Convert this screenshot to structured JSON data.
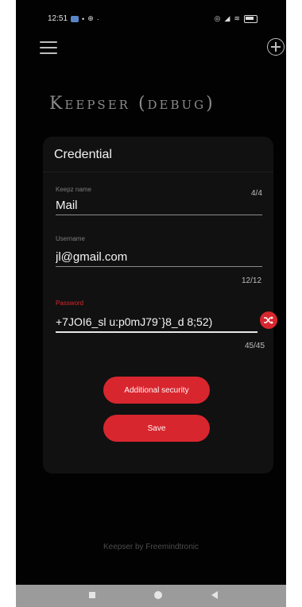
{
  "status_bar": {
    "time": "12:51"
  },
  "app": {
    "title": "Keepser (debug)"
  },
  "credential_form": {
    "title": "Credential",
    "fields": [
      {
        "label": "Keepz name",
        "value": "Mail",
        "counter": "4/4"
      },
      {
        "label": "Username",
        "value": "jl@gmail.com",
        "counter": "12/12"
      },
      {
        "label": "Password",
        "value": "+7JOI6_sl u:p0mJ79`}8_d 8;52)",
        "counter": "45/45"
      }
    ],
    "additional_security_label": "Additional security",
    "save_label": "Save"
  },
  "footer": {
    "text": "Keepser by Freemindtronic"
  },
  "colors": {
    "accent": "#d8262f",
    "background": "#020202",
    "card": "#111111"
  },
  "icons": {
    "menu": "menu-icon",
    "add": "add-circle-icon",
    "shuffle": "shuffle-icon"
  }
}
